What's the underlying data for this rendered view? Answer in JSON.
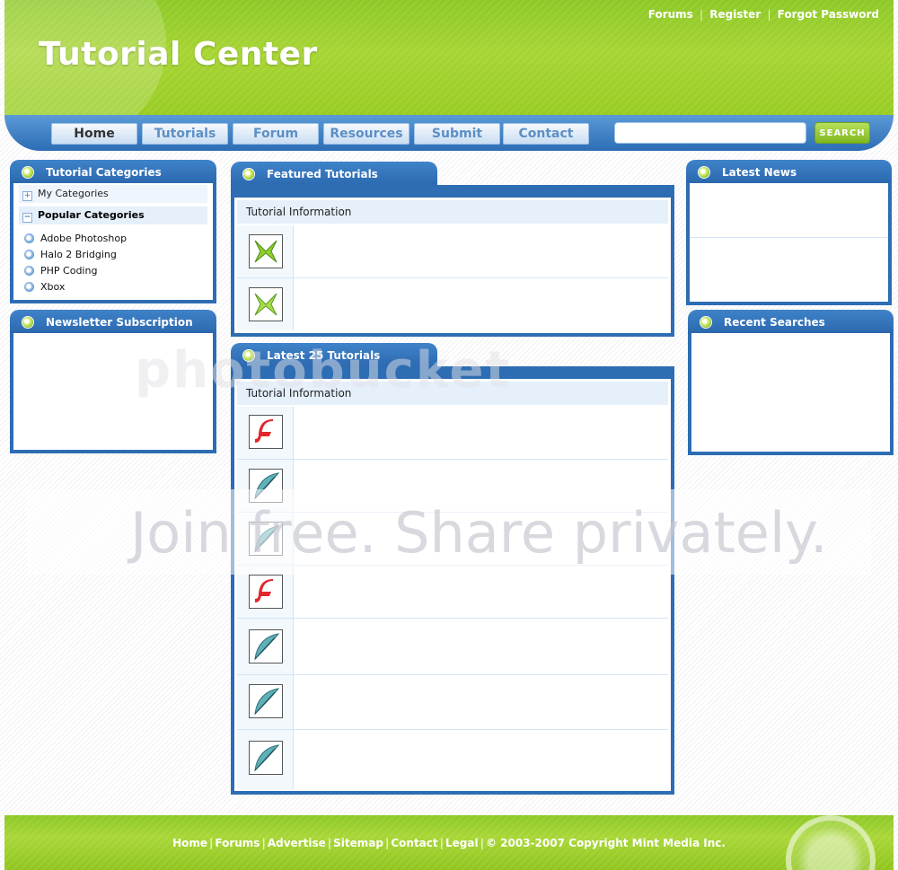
{
  "site": {
    "title": "Tutorial Center"
  },
  "toplinks": {
    "forums": "Forums",
    "register": "Register",
    "forgot": "Forgot Password",
    "sep": "|"
  },
  "nav": {
    "items": [
      "Home",
      "Tutorials",
      "Forum",
      "Resources",
      "Submit",
      "Contact"
    ],
    "active": "Home",
    "search_button": "SEARCH",
    "search_value": ""
  },
  "left": {
    "categories_title": "Tutorial Categories",
    "my_categories": "My Categories",
    "popular_categories": "Popular Categories",
    "expand_symbol": "+",
    "collapse_symbol": "−",
    "popular_items": [
      "Adobe Photoshop",
      "Halo 2 Bridging",
      "PHP Coding",
      "Xbox"
    ],
    "newsletter_title": "Newsletter Subscription"
  },
  "center": {
    "featured_title": "Featured Tutorials",
    "featured_info_header": "Tutorial Information",
    "featured_rows": [
      "xbox-icon",
      "xbox-icon"
    ],
    "latest_title": "Latest 25 Tutorials",
    "latest_info_header": "Tutorial Information",
    "latest_rows": [
      "flash-icon",
      "feather-icon",
      "feather-icon",
      "flash-icon",
      "feather-icon",
      "feather-icon",
      "feather-icon"
    ]
  },
  "right": {
    "news_title": "Latest News",
    "searches_title": "Recent Searches"
  },
  "footer": {
    "links": [
      "Home",
      "Forums",
      "Advertise",
      "Sitemap",
      "Contact",
      "Legal"
    ],
    "copyright": "© 2003-2007 Copyright Mint Media Inc."
  },
  "watermark": {
    "line1": "photobucket",
    "line2": "Join free. Share privately."
  },
  "colors": {
    "green": "#97cc20",
    "blue": "#2d6db3",
    "light_blue": "#e5f0fb"
  }
}
